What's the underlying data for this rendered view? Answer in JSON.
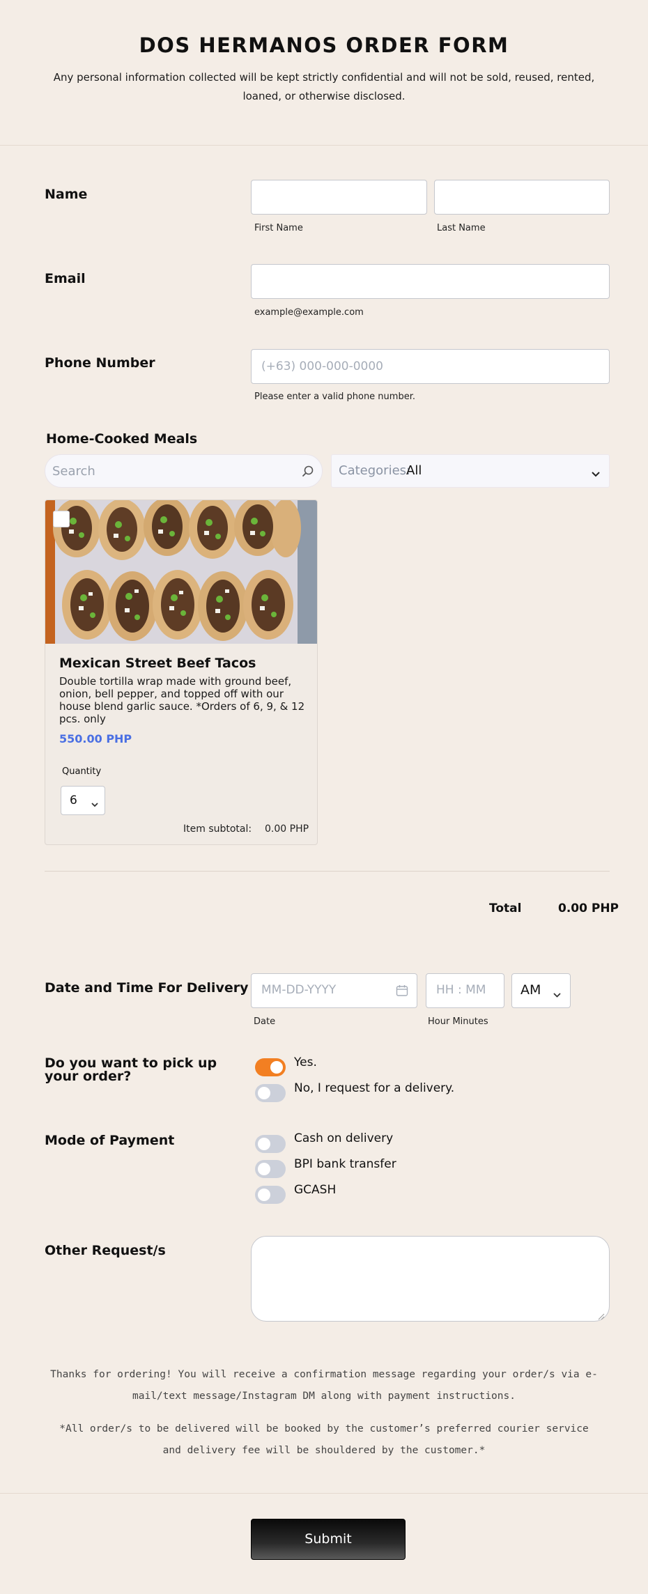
{
  "header": {
    "title": "DOS HERMANOS ORDER FORM",
    "subtitle": "Any personal information collected will be kept strictly confidential and will not be sold, reused, rented, loaned, or otherwise disclosed."
  },
  "name": {
    "label": "Name",
    "first_value": "",
    "last_value": "",
    "first_sublabel": "First Name",
    "last_sublabel": "Last Name"
  },
  "email": {
    "label": "Email",
    "value": "",
    "sublabel": "example@example.com"
  },
  "phone": {
    "label": "Phone Number",
    "placeholder": "(+63) 000-000-0000",
    "sublabel": "Please enter a valid phone number."
  },
  "meals": {
    "section_title": "Home-Cooked Meals",
    "search_placeholder": "Search",
    "categories_label": "Categories:",
    "categories_value": "All",
    "product": {
      "name": "Mexican Street Beef Tacos",
      "description": "Double tortilla wrap made with ground beef, onion, bell pepper, and topped off with our house blend garlic sauce. *Orders of 6, 9, & 12 pcs. only",
      "price": "550.00 PHP",
      "quantity_label": "Quantity",
      "quantity_value": "6",
      "subtotal_label": "Item subtotal:",
      "subtotal_value": "0.00 PHP"
    },
    "total_label": "Total",
    "total_value": "0.00 PHP"
  },
  "delivery": {
    "label": "Date and Time For Delivery",
    "date_placeholder": "MM-DD-YYYY",
    "time_placeholder": "HH : MM",
    "ampm_value": "AM",
    "date_sublabel": "Date",
    "time_sublabel": "Hour Minutes"
  },
  "pickup": {
    "label": "Do you want to pick up your order?",
    "options": [
      {
        "label": "Yes.",
        "on": true
      },
      {
        "label": "No, I request for a delivery.",
        "on": false
      }
    ]
  },
  "payment": {
    "label": "Mode of Payment",
    "options": [
      {
        "label": "Cash on delivery",
        "on": false
      },
      {
        "label": "BPI bank transfer",
        "on": false
      },
      {
        "label": "GCASH",
        "on": false
      }
    ]
  },
  "requests": {
    "label": "Other Request/s",
    "value": ""
  },
  "notes": {
    "thanks": "Thanks for ordering! You will receive a confirmation message regarding your order/s via e-mail/text message/Instagram DM along with payment instructions.",
    "courier": "*All order/s to be delivered will be booked by the customer’s preferred courier service and delivery fee will be shouldered by the customer.*"
  },
  "submit_label": "Submit",
  "colors": {
    "background": "#f4ede6",
    "price_blue": "#4a6fe3",
    "toggle_on": "#f27f22",
    "toggle_off": "#ccd0da"
  }
}
